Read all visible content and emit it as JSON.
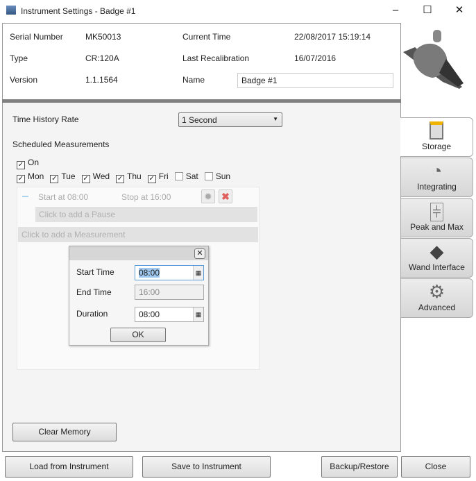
{
  "window": {
    "title": "Instrument Settings - Badge #1",
    "icon": "app-icon",
    "minimize": "–",
    "maximize": "☐",
    "close": "✕"
  },
  "info": {
    "serial_label": "Serial Number",
    "serial": "MK50013",
    "type_label": "Type",
    "type": "CR:120A",
    "version_label": "Version",
    "version": "1.1.1564",
    "time_label": "Current Time",
    "time": "22/08/2017 15:19:14",
    "recal_label": "Last Recalibration",
    "recal": "16/07/2016",
    "name_label": "Name",
    "name": "Badge #1"
  },
  "storage": {
    "rate_label": "Time History Rate",
    "rate": "1 Second",
    "sched_label": "Scheduled Measurements",
    "on_label": "On",
    "on": true,
    "days": [
      {
        "label": "Mon",
        "checked": true
      },
      {
        "label": "Tue",
        "checked": true
      },
      {
        "label": "Wed",
        "checked": true
      },
      {
        "label": "Thu",
        "checked": true
      },
      {
        "label": "Fri",
        "checked": true
      },
      {
        "label": "Sat",
        "checked": false
      },
      {
        "label": "Sun",
        "checked": false
      }
    ],
    "measurement": {
      "start": "Start at 08:00",
      "stop": "Stop at 16:00",
      "add_pause": "Click to add a Pause"
    },
    "add_measurement": "Click to add a Measurement",
    "clear_memory": "Clear Memory"
  },
  "dialog": {
    "start_label": "Start Time",
    "start": "08:00",
    "end_label": "End Time",
    "end": "16:00",
    "duration_label": "Duration",
    "duration": "08:00",
    "ok": "OK"
  },
  "tabs": [
    {
      "label": "Storage",
      "icon": "sd-card-icon",
      "active": true
    },
    {
      "label": "Integrating",
      "icon": "gauge-icon"
    },
    {
      "label": "Peak and Max",
      "icon": "sliders-icon"
    },
    {
      "label": "Wand Interface",
      "icon": "wand-icon"
    },
    {
      "label": "Advanced",
      "icon": "gear-icon"
    }
  ],
  "footer": {
    "load": "Load from Instrument",
    "save": "Save to Instrument",
    "backup": "Backup/Restore",
    "close": "Close"
  }
}
